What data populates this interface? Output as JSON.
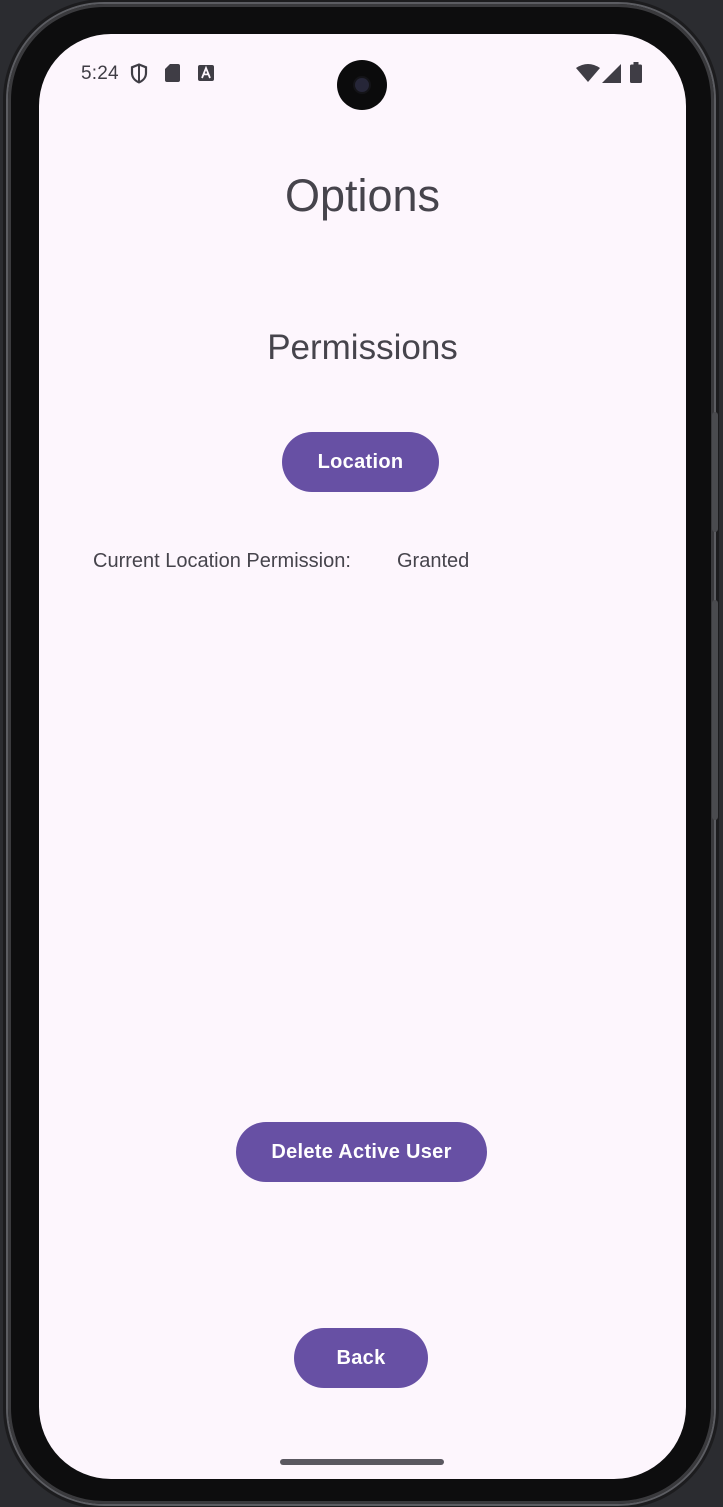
{
  "status_bar": {
    "time": "5:24",
    "left_icons": [
      "shield-icon",
      "sd-card-icon",
      "font-a-icon"
    ],
    "right_icons": [
      "wifi-icon",
      "cell-signal-icon",
      "battery-icon"
    ]
  },
  "screen": {
    "title": "Options",
    "section_title": "Permissions",
    "location_button_label": "Location",
    "permission_label": "Current Location Permission:",
    "permission_value": "Granted",
    "delete_button_label": "Delete Active User",
    "back_button_label": "Back"
  },
  "colors": {
    "background": "#fdf6fd",
    "button": "#6750a4",
    "button_text": "#ffffff",
    "text": "#46444c"
  }
}
